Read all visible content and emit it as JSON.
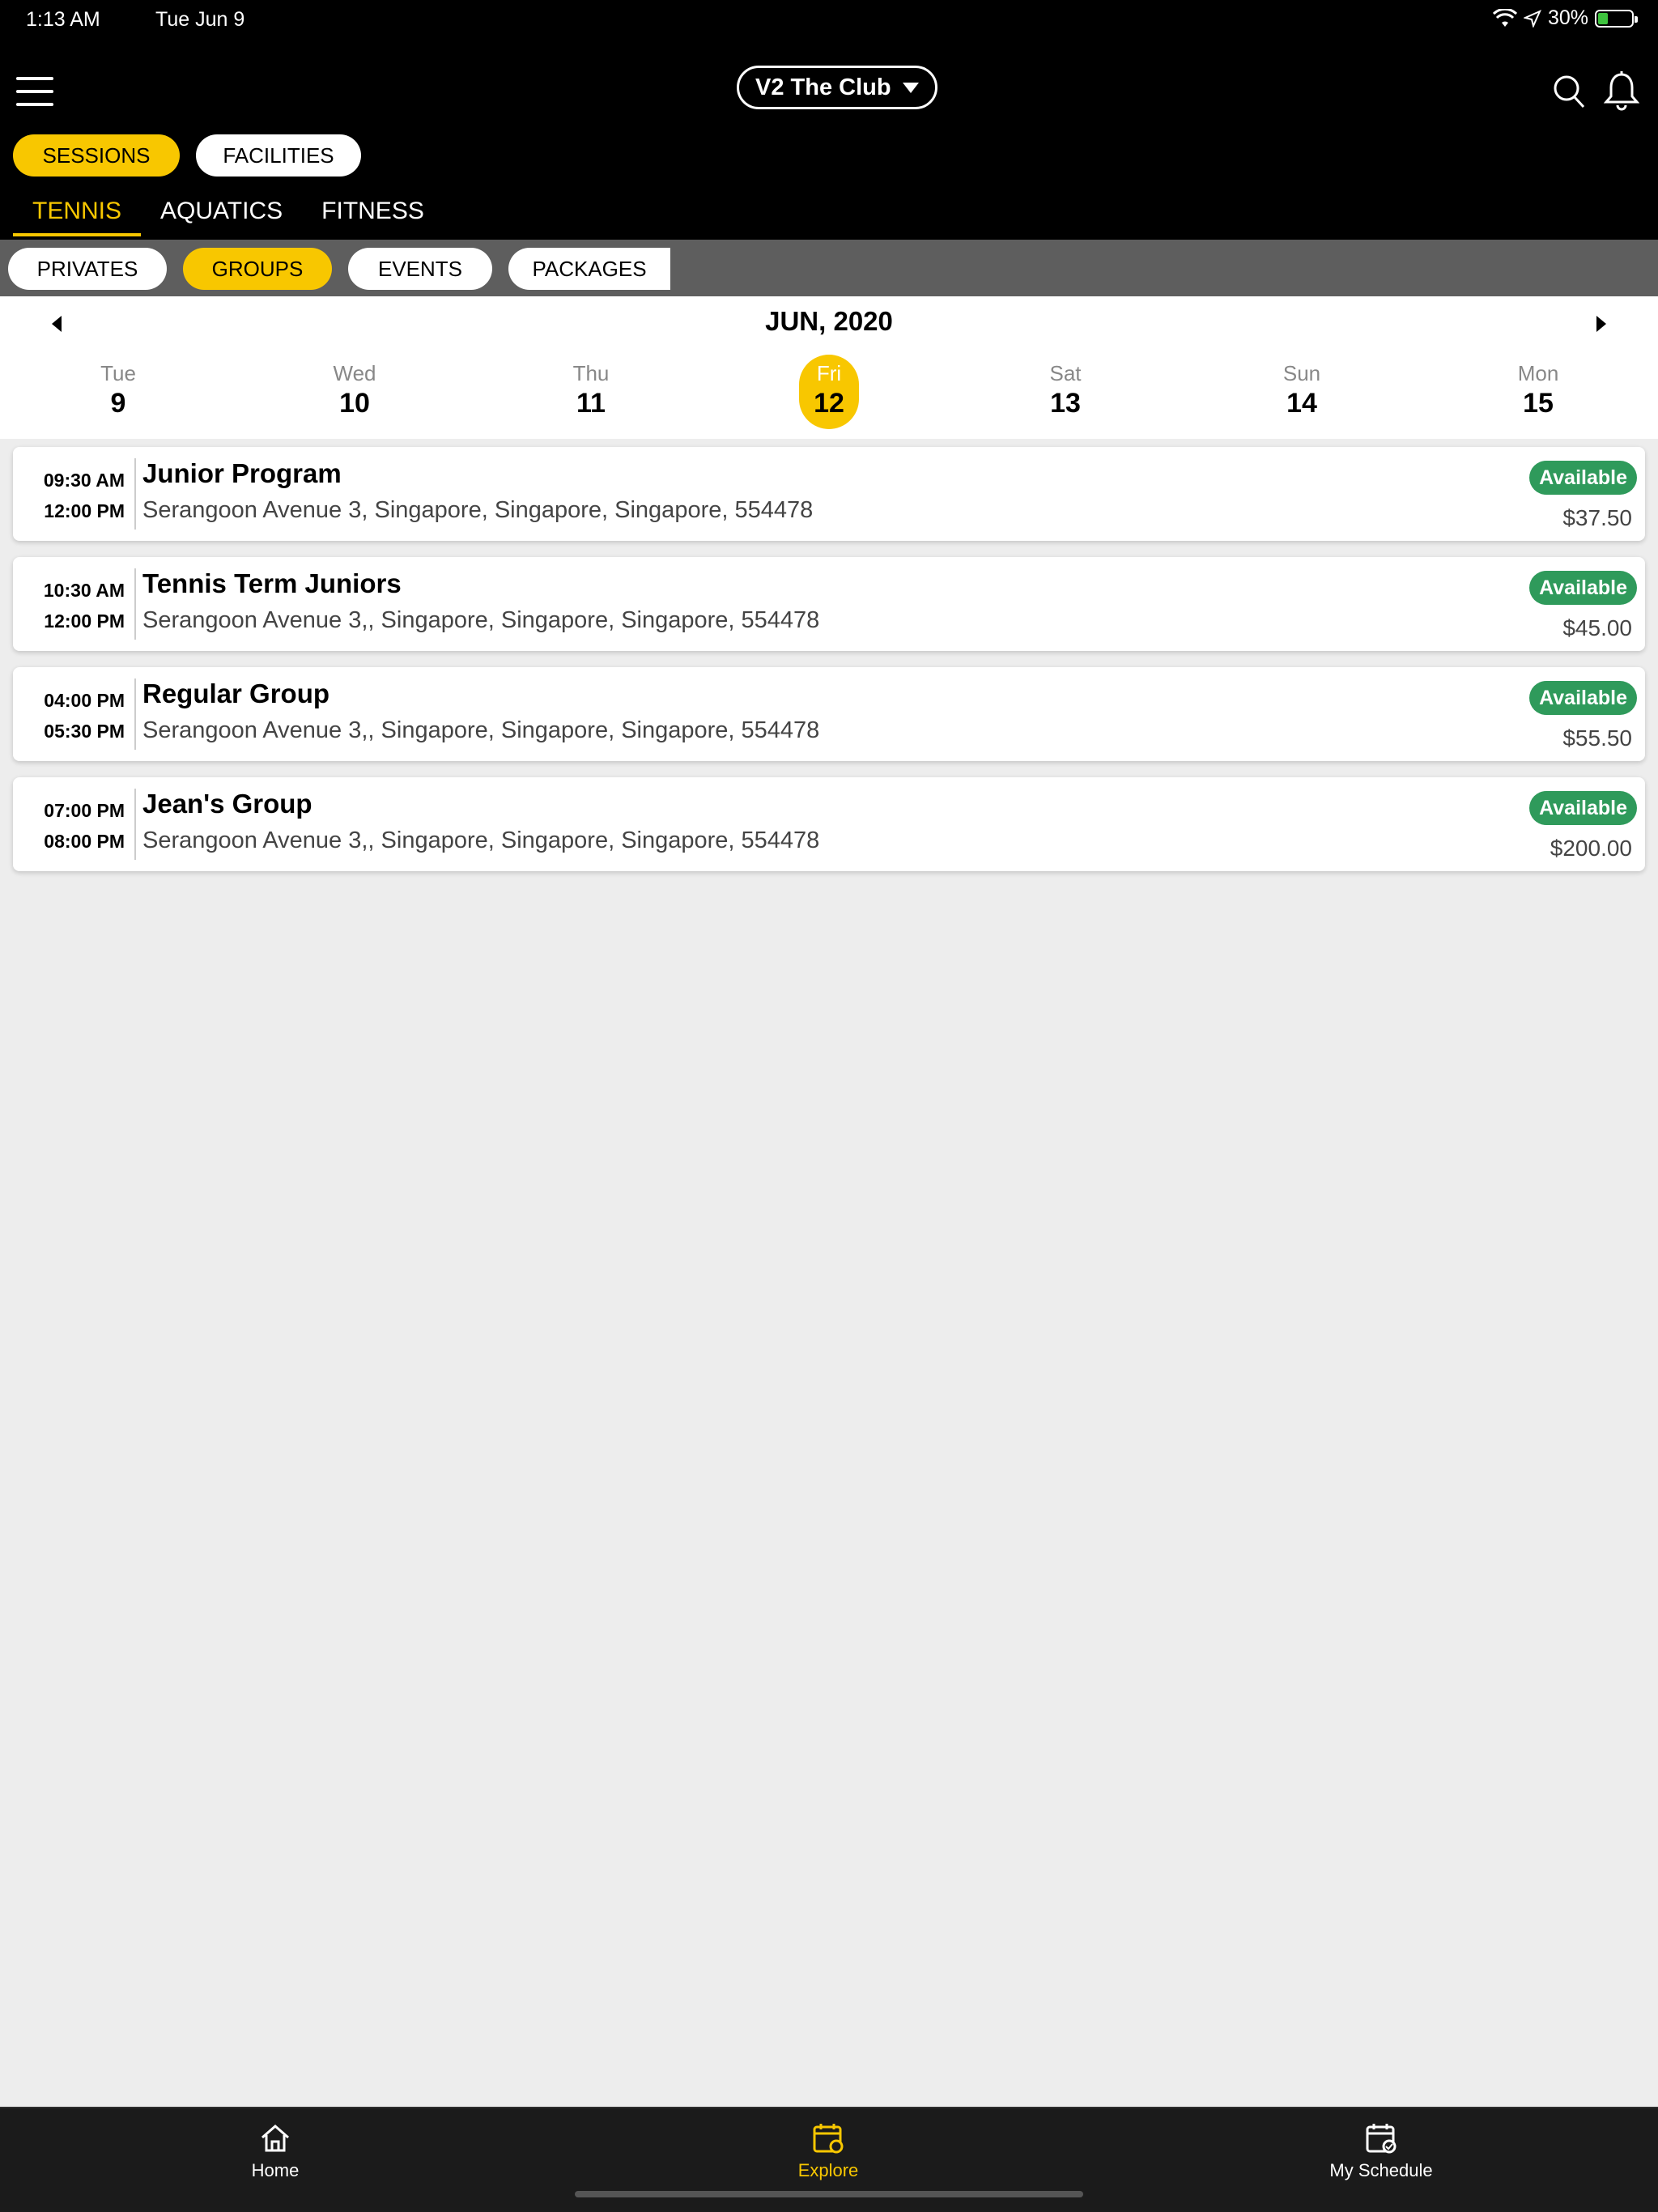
{
  "status_bar": {
    "time": "1:13 AM",
    "date": "Tue Jun 9",
    "battery": "30%",
    "battery_level": 0.3
  },
  "header": {
    "club_name": "V2 The Club",
    "toggles": [
      "SESSIONS",
      "FACILITIES"
    ],
    "sport_tabs": [
      "TENNIS",
      "AQUATICS",
      "FITNESS"
    ]
  },
  "filters": [
    "PRIVATES",
    "GROUPS",
    "EVENTS",
    "PACKAGES"
  ],
  "calendar": {
    "month": "JUN, 2020",
    "days": [
      {
        "name": "Tue",
        "num": "9"
      },
      {
        "name": "Wed",
        "num": "10"
      },
      {
        "name": "Thu",
        "num": "11"
      },
      {
        "name": "Fri",
        "num": "12"
      },
      {
        "name": "Sat",
        "num": "13"
      },
      {
        "name": "Sun",
        "num": "14"
      },
      {
        "name": "Mon",
        "num": "15"
      }
    ]
  },
  "sessions": [
    {
      "start": "09:30 AM",
      "end": "12:00 PM",
      "title": "Junior Program",
      "address": "Serangoon Avenue 3, Singapore, Singapore, Singapore, 554478",
      "status": "Available",
      "price": "$37.50"
    },
    {
      "start": "10:30 AM",
      "end": "12:00 PM",
      "title": "Tennis Term Juniors",
      "address": "Serangoon Avenue 3,, Singapore, Singapore, Singapore, 554478",
      "status": "Available",
      "price": "$45.00"
    },
    {
      "start": "04:00 PM",
      "end": "05:30 PM",
      "title": "Regular Group",
      "address": "Serangoon Avenue 3,, Singapore, Singapore, Singapore, 554478",
      "status": "Available",
      "price": "$55.50"
    },
    {
      "start": "07:00 PM",
      "end": "08:00 PM",
      "title": "Jean's Group",
      "address": "Serangoon Avenue 3,, Singapore, Singapore, Singapore, 554478",
      "status": "Available",
      "price": "$200.00"
    }
  ],
  "tabbar": {
    "home": "Home",
    "explore": "Explore",
    "schedule": "My Schedule"
  },
  "colors": {
    "accent": "#f8c700",
    "available": "#2f9a5b",
    "header_bg": "#000000",
    "filter_bg": "#5e5e5e"
  }
}
